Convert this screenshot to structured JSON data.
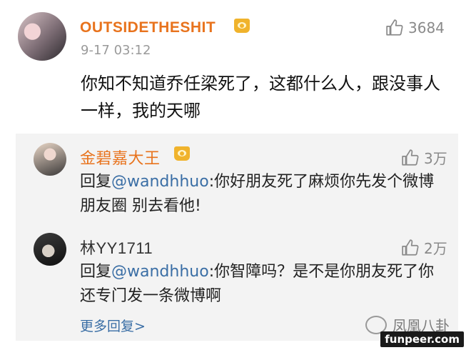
{
  "main_comment": {
    "username": "OUTSIDETHESHIT",
    "timestamp": "9-17 03:12",
    "likes": "3684",
    "text": "你知不知道乔任梁死了，这都什么人，跟没事人一样，我的天哪"
  },
  "replies": [
    {
      "username": "金碧嘉大王",
      "likes": "3万",
      "prefix": "回复",
      "mention": "@wandhhuo",
      "text": ":你好朋友死了麻烦你先发个微博 朋友圈 别去看他!"
    },
    {
      "username": "林YY1711",
      "likes": "2万",
      "prefix": "回复",
      "mention": "@wandhhuo",
      "text": ":你智障吗？是不是你朋友死了你还专门发一条微博啊"
    }
  ],
  "more_replies": "更多回复>",
  "watermark": "凤凰八卦",
  "site_tag": "funpeer.com",
  "colors": {
    "vip_name": "#e8731d",
    "link": "#3a6ea5",
    "reply_bg": "#f3f3f3",
    "crown": "#f0b32c"
  },
  "icons": [
    "crown-icon",
    "thumbs-up-icon",
    "wechat-icon"
  ]
}
